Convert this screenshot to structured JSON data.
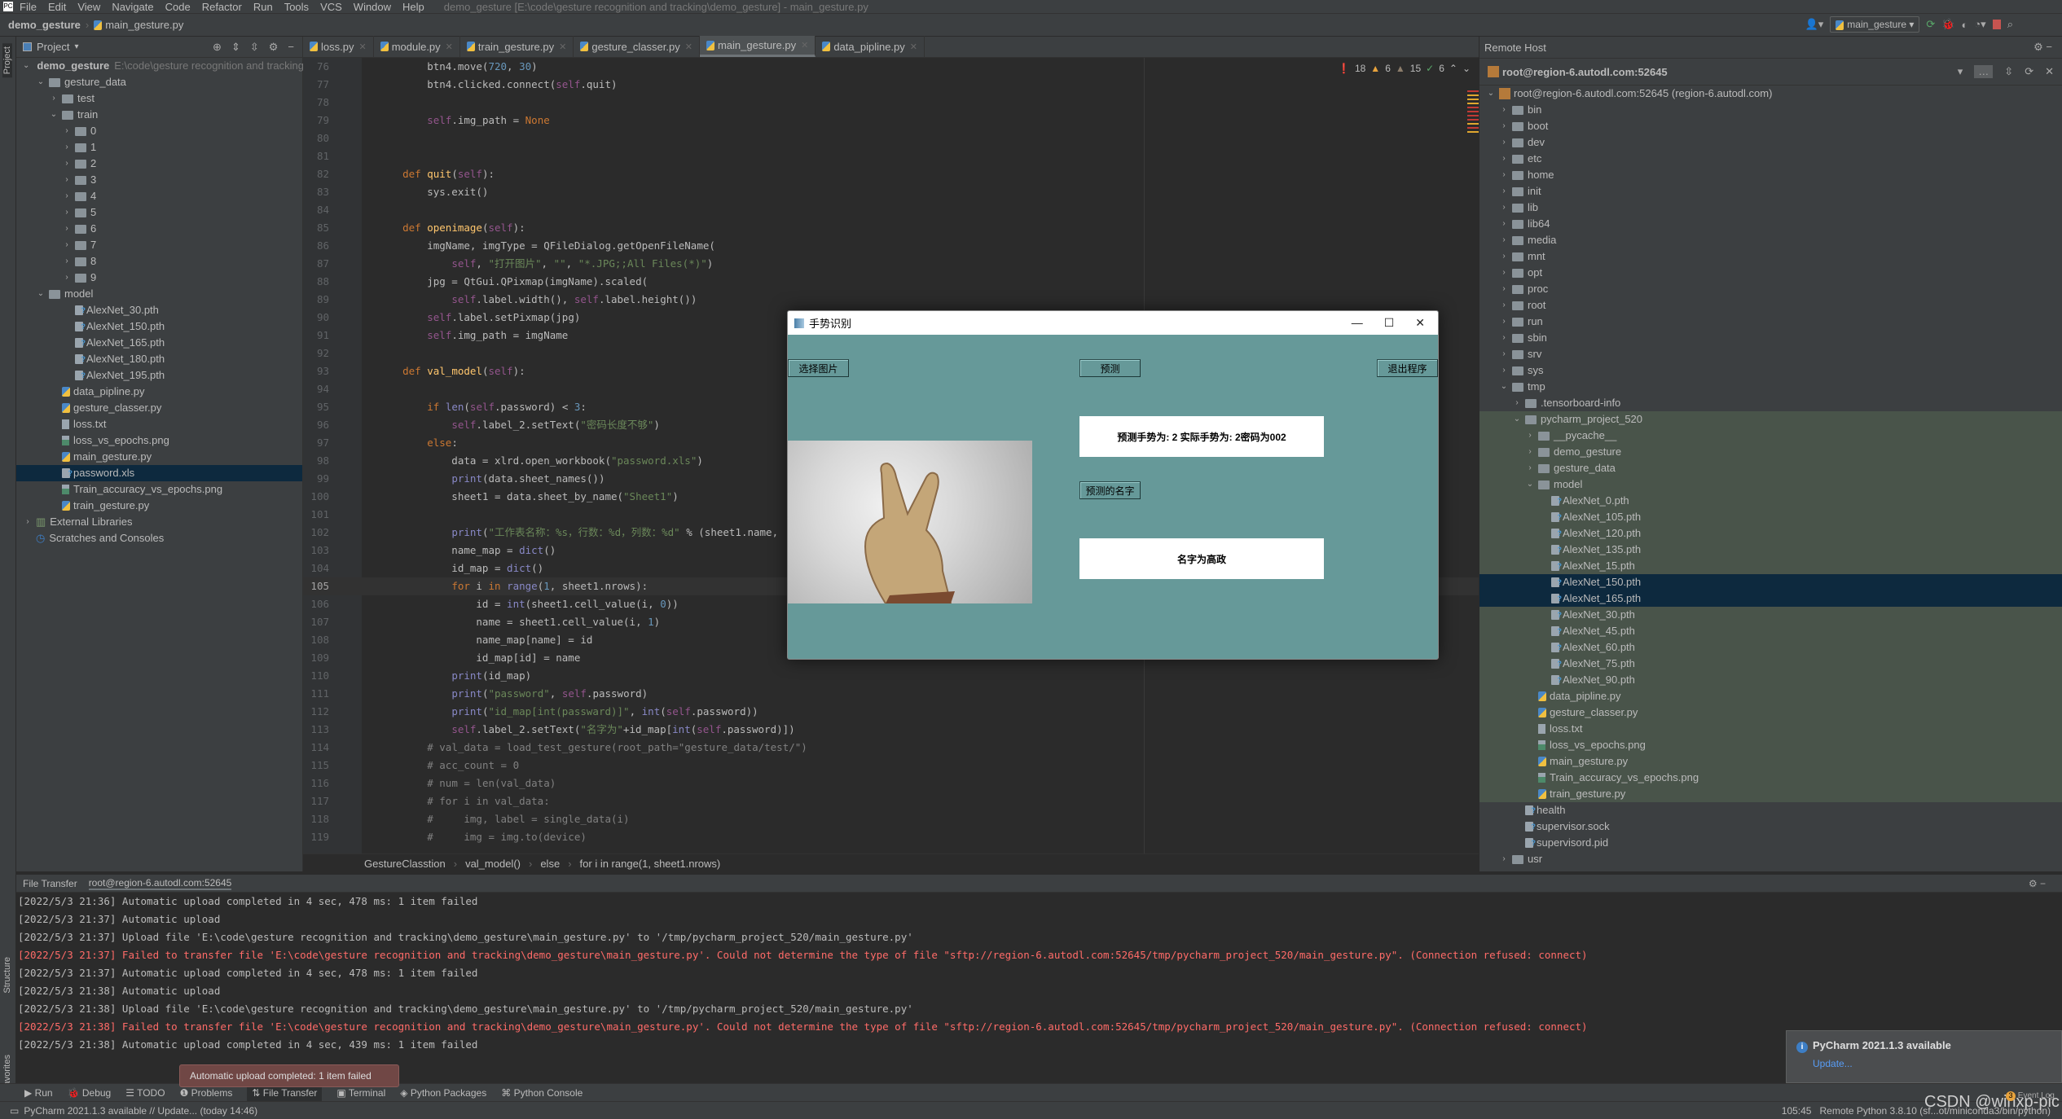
{
  "menubar": {
    "items": [
      "File",
      "Edit",
      "View",
      "Navigate",
      "Code",
      "Refactor",
      "Run",
      "Tools",
      "VCS",
      "Window",
      "Help"
    ],
    "window_title": "demo_gesture [E:\\code\\gesture recognition and tracking\\demo_gesture] - main_gesture.py"
  },
  "navbar": {
    "project": "demo_gesture",
    "file": "main_gesture.py",
    "run_config": "main_gesture"
  },
  "project_panel": {
    "title": "Project",
    "root": "demo_gesture",
    "root_path": "E:\\code\\gesture recognition and tracking",
    "items": [
      {
        "label": "gesture_data",
        "type": "folder",
        "depth": 1,
        "expanded": true
      },
      {
        "label": "test",
        "type": "folder",
        "depth": 2,
        "expanded": false
      },
      {
        "label": "train",
        "type": "folder",
        "depth": 2,
        "expanded": true
      },
      {
        "label": "0",
        "type": "folder",
        "depth": 3,
        "expanded": false
      },
      {
        "label": "1",
        "type": "folder",
        "depth": 3,
        "expanded": false
      },
      {
        "label": "2",
        "type": "folder",
        "depth": 3,
        "expanded": false
      },
      {
        "label": "3",
        "type": "folder",
        "depth": 3,
        "expanded": false
      },
      {
        "label": "4",
        "type": "folder",
        "depth": 3,
        "expanded": false
      },
      {
        "label": "5",
        "type": "folder",
        "depth": 3,
        "expanded": false
      },
      {
        "label": "6",
        "type": "folder",
        "depth": 3,
        "expanded": false
      },
      {
        "label": "7",
        "type": "folder",
        "depth": 3,
        "expanded": false
      },
      {
        "label": "8",
        "type": "folder",
        "depth": 3,
        "expanded": false
      },
      {
        "label": "9",
        "type": "folder",
        "depth": 3,
        "expanded": false
      },
      {
        "label": "model",
        "type": "folder",
        "depth": 1,
        "expanded": true
      },
      {
        "label": "AlexNet_30.pth",
        "type": "unknown",
        "depth": 3
      },
      {
        "label": "AlexNet_150.pth",
        "type": "unknown",
        "depth": 3
      },
      {
        "label": "AlexNet_165.pth",
        "type": "unknown",
        "depth": 3
      },
      {
        "label": "AlexNet_180.pth",
        "type": "unknown",
        "depth": 3
      },
      {
        "label": "AlexNet_195.pth",
        "type": "unknown",
        "depth": 3
      },
      {
        "label": "data_pipline.py",
        "type": "py",
        "depth": 2
      },
      {
        "label": "gesture_classer.py",
        "type": "py",
        "depth": 2
      },
      {
        "label": "loss.txt",
        "type": "txt",
        "depth": 2
      },
      {
        "label": "loss_vs_epochs.png",
        "type": "img",
        "depth": 2
      },
      {
        "label": "main_gesture.py",
        "type": "py",
        "depth": 2
      },
      {
        "label": "password.xls",
        "type": "unknown",
        "depth": 2,
        "selected": true
      },
      {
        "label": "Train_accuracy_vs_epochs.png",
        "type": "img",
        "depth": 2
      },
      {
        "label": "train_gesture.py",
        "type": "py",
        "depth": 2
      }
    ],
    "external_libraries": "External Libraries",
    "scratches": "Scratches and Consoles"
  },
  "tabs": [
    {
      "label": "loss.py",
      "active": false
    },
    {
      "label": "module.py",
      "active": false
    },
    {
      "label": "train_gesture.py",
      "active": false
    },
    {
      "label": "gesture_classer.py",
      "active": false
    },
    {
      "label": "main_gesture.py",
      "active": true
    },
    {
      "label": "data_pipline.py",
      "active": false
    }
  ],
  "inspections": {
    "errors": "18",
    "warnings": "6",
    "weak_warnings": "15",
    "typos": "6"
  },
  "code": [
    {
      "n": "76",
      "html": "        btn4.move(<span class=nm>720</span>, <span class=nm>30</span>)"
    },
    {
      "n": "77",
      "html": "        btn4.clicked.connect(<span class=sf>self</span>.quit)"
    },
    {
      "n": "78",
      "html": ""
    },
    {
      "n": "79",
      "html": "        <span class=sf>self</span>.img_path = <span class=kw>None</span>"
    },
    {
      "n": "80",
      "html": ""
    },
    {
      "n": "81",
      "html": ""
    },
    {
      "n": "82",
      "html": "    <span class=kw>def</span> <span class=fn>quit</span>(<span class=sf>self</span>):"
    },
    {
      "n": "83",
      "html": "        sys.exit()"
    },
    {
      "n": "84",
      "html": ""
    },
    {
      "n": "85",
      "html": "    <span class=kw>def</span> <span class=fn>openimage</span>(<span class=sf>self</span>):"
    },
    {
      "n": "86",
      "html": "        imgName, imgType = QFileDialog.getOpenFileName("
    },
    {
      "n": "87",
      "html": "            <span class=sf>self</span>, <span class=st>\"打开图片\"</span>, <span class=st>\"\"</span>, <span class=st>\"*.JPG;;All Files(*)\"</span>)"
    },
    {
      "n": "88",
      "html": "        jpg = QtGui.QPixmap(imgName).scaled("
    },
    {
      "n": "89",
      "html": "            <span class=sf>self</span>.label.width(), <span class=sf>self</span>.label.height())"
    },
    {
      "n": "90",
      "html": "        <span class=sf>self</span>.label.setPixmap(jpg)"
    },
    {
      "n": "91",
      "html": "        <span class=sf>self</span>.img_path = imgName"
    },
    {
      "n": "92",
      "html": ""
    },
    {
      "n": "93",
      "html": "    <span class=kw>def</span> <span class=fn>val_model</span>(<span class=sf>self</span>):"
    },
    {
      "n": "94",
      "html": ""
    },
    {
      "n": "95",
      "html": "        <span class=kw>if</span> <span class=bi>len</span>(<span class=sf>self</span>.password) &lt; <span class=nm>3</span>:"
    },
    {
      "n": "96",
      "html": "            <span class=sf>self</span>.label_2.setText(<span class=st>\"密码长度不够\"</span>)"
    },
    {
      "n": "97",
      "html": "        <span class=kw>else</span>:"
    },
    {
      "n": "98",
      "html": "            data = xlrd.open_workbook(<span class=st>\"password.xls\"</span>)"
    },
    {
      "n": "99",
      "html": "            <span class=bi>print</span>(data.sheet_names())"
    },
    {
      "n": "100",
      "html": "            sheet1 = data.sheet_by_name(<span class=st>\"Sheet1\"</span>)"
    },
    {
      "n": "101",
      "html": ""
    },
    {
      "n": "102",
      "html": "            <span class=bi>print</span>(<span class=st>\"工作表名称：%s，行数：%d，列数：%d\"</span> % (sheet1.name,"
    },
    {
      "n": "103",
      "html": "            name_map = <span class=bi>dict</span>()"
    },
    {
      "n": "104",
      "html": "            id_map = <span class=bi>dict</span>()"
    },
    {
      "n": "105",
      "html": "            <span class=kw>for</span> i <span class=kw>in</span> <span class=bi>range</span>(<span class=nm>1</span>, sheet1.nrows):",
      "cur": true
    },
    {
      "n": "106",
      "html": "                id = <span class=bi>int</span>(sheet1.cell_value(i, <span class=nm>0</span>))"
    },
    {
      "n": "107",
      "html": "                name = sheet1.cell_value(i, <span class=nm>1</span>)"
    },
    {
      "n": "108",
      "html": "                name_map[name] = id"
    },
    {
      "n": "109",
      "html": "                id_map[id] = name"
    },
    {
      "n": "110",
      "html": "            <span class=bi>print</span>(id_map)"
    },
    {
      "n": "111",
      "html": "            <span class=bi>print</span>(<span class=st>\"password\"</span>, <span class=sf>self</span>.password)"
    },
    {
      "n": "112",
      "html": "            <span class=bi>print</span>(<span class=st>\"id_map[int(passward)]\"</span>, <span class=bi>int</span>(<span class=sf>self</span>.password))"
    },
    {
      "n": "113",
      "html": "            <span class=sf>self</span>.label_2.setText(<span class=st>\"名字为\"</span>+id_map[<span class=bi>int</span>(<span class=sf>self</span>.password)])"
    },
    {
      "n": "114",
      "html": "        <span class=cm># val_data = load_test_gesture(root_path=\"gesture_data/test/\")</span>"
    },
    {
      "n": "115",
      "html": "        <span class=cm># acc_count = 0</span>"
    },
    {
      "n": "116",
      "html": "        <span class=cm># num = len(val_data)</span>"
    },
    {
      "n": "117",
      "html": "        <span class=cm># for i in val_data:</span>"
    },
    {
      "n": "118",
      "html": "        <span class=cm>#     img, label = single_data(i)</span>"
    },
    {
      "n": "119",
      "html": "        <span class=cm>#     img = img.to(device)</span>"
    }
  ],
  "breadcrumb": [
    "GestureClasstion",
    "val_model()",
    "else",
    "for i in range(1, sheet1.nrows)"
  ],
  "remote": {
    "title": "Remote Host",
    "host": "root@region-6.autodl.com:52645",
    "root_label": "root@region-6.autodl.com:52645 (region-6.autodl.com)",
    "items": [
      {
        "label": "bin",
        "type": "folder",
        "depth": 1
      },
      {
        "label": "boot",
        "type": "folder",
        "depth": 1
      },
      {
        "label": "dev",
        "type": "folder",
        "depth": 1
      },
      {
        "label": "etc",
        "type": "folder",
        "depth": 1
      },
      {
        "label": "home",
        "type": "folder",
        "depth": 1
      },
      {
        "label": "init",
        "type": "folder",
        "depth": 1
      },
      {
        "label": "lib",
        "type": "folder",
        "depth": 1
      },
      {
        "label": "lib64",
        "type": "folder",
        "depth": 1
      },
      {
        "label": "media",
        "type": "folder",
        "depth": 1
      },
      {
        "label": "mnt",
        "type": "folder",
        "depth": 1
      },
      {
        "label": "opt",
        "type": "folder",
        "depth": 1
      },
      {
        "label": "proc",
        "type": "folder",
        "depth": 1
      },
      {
        "label": "root",
        "type": "folder",
        "depth": 1
      },
      {
        "label": "run",
        "type": "folder",
        "depth": 1
      },
      {
        "label": "sbin",
        "type": "folder",
        "depth": 1
      },
      {
        "label": "srv",
        "type": "folder",
        "depth": 1
      },
      {
        "label": "sys",
        "type": "folder",
        "depth": 1
      },
      {
        "label": "tmp",
        "type": "folder",
        "depth": 1,
        "expanded": true
      },
      {
        "label": ".tensorboard-info",
        "type": "folder",
        "depth": 2
      },
      {
        "label": "pycharm_project_520",
        "type": "folder",
        "depth": 2,
        "expanded": true,
        "mapped": true
      },
      {
        "label": "__pycache__",
        "type": "folder",
        "depth": 3,
        "mapped": true
      },
      {
        "label": "demo_gesture",
        "type": "folder",
        "depth": 3,
        "mapped": true
      },
      {
        "label": "gesture_data",
        "type": "folder",
        "depth": 3,
        "mapped": true
      },
      {
        "label": "model",
        "type": "folder",
        "depth": 3,
        "expanded": true,
        "mapped": true
      },
      {
        "label": "AlexNet_0.pth",
        "type": "unknown",
        "depth": 4,
        "mapped": true
      },
      {
        "label": "AlexNet_105.pth",
        "type": "unknown",
        "depth": 4,
        "mapped": true
      },
      {
        "label": "AlexNet_120.pth",
        "type": "unknown",
        "depth": 4,
        "mapped": true
      },
      {
        "label": "AlexNet_135.pth",
        "type": "unknown",
        "depth": 4,
        "mapped": true
      },
      {
        "label": "AlexNet_15.pth",
        "type": "unknown",
        "depth": 4,
        "mapped": true
      },
      {
        "label": "AlexNet_150.pth",
        "type": "unknown",
        "depth": 4,
        "selected": true
      },
      {
        "label": "AlexNet_165.pth",
        "type": "unknown",
        "depth": 4,
        "selected": true
      },
      {
        "label": "AlexNet_30.pth",
        "type": "unknown",
        "depth": 4,
        "mapped": true
      },
      {
        "label": "AlexNet_45.pth",
        "type": "unknown",
        "depth": 4,
        "mapped": true
      },
      {
        "label": "AlexNet_60.pth",
        "type": "unknown",
        "depth": 4,
        "mapped": true
      },
      {
        "label": "AlexNet_75.pth",
        "type": "unknown",
        "depth": 4,
        "mapped": true
      },
      {
        "label": "AlexNet_90.pth",
        "type": "unknown",
        "depth": 4,
        "mapped": true
      },
      {
        "label": "data_pipline.py",
        "type": "py",
        "depth": 3,
        "mapped": true
      },
      {
        "label": "gesture_classer.py",
        "type": "py",
        "depth": 3,
        "mapped": true
      },
      {
        "label": "loss.txt",
        "type": "txt",
        "depth": 3,
        "mapped": true
      },
      {
        "label": "loss_vs_epochs.png",
        "type": "img",
        "depth": 3,
        "mapped": true
      },
      {
        "label": "main_gesture.py",
        "type": "py",
        "depth": 3,
        "mapped": true
      },
      {
        "label": "Train_accuracy_vs_epochs.png",
        "type": "img",
        "depth": 3,
        "mapped": true
      },
      {
        "label": "train_gesture.py",
        "type": "py",
        "depth": 3,
        "mapped": true
      },
      {
        "label": "health",
        "type": "unknown",
        "depth": 2
      },
      {
        "label": "supervisor.sock",
        "type": "unknown",
        "depth": 2
      },
      {
        "label": "supervisord.pid",
        "type": "unknown",
        "depth": 2
      },
      {
        "label": "usr",
        "type": "folder",
        "depth": 1
      }
    ]
  },
  "bottom_panel": {
    "tabs": [
      "File Transfer",
      "root@region-6.autodl.com:52645"
    ],
    "log": [
      {
        "text": "[2022/5/3 21:36] Automatic upload completed in 4 sec, 478 ms: 1 item failed",
        "err": false
      },
      {
        "text": "[2022/5/3 21:37] Automatic upload",
        "err": false
      },
      {
        "text": "[2022/5/3 21:37] Upload file 'E:\\code\\gesture recognition and tracking\\demo_gesture\\main_gesture.py' to '/tmp/pycharm_project_520/main_gesture.py'",
        "err": false
      },
      {
        "text": "[2022/5/3 21:37] Failed to transfer file 'E:\\code\\gesture recognition and tracking\\demo_gesture\\main_gesture.py'. Could not determine the type of file \"sftp://region-6.autodl.com:52645/tmp/pycharm_project_520/main_gesture.py\". (Connection refused: connect)",
        "err": true
      },
      {
        "text": "[2022/5/3 21:37] Automatic upload completed in 4 sec, 478 ms: 1 item failed",
        "err": false
      },
      {
        "text": "[2022/5/3 21:38] Automatic upload",
        "err": false
      },
      {
        "text": "[2022/5/3 21:38] Upload file 'E:\\code\\gesture recognition and tracking\\demo_gesture\\main_gesture.py' to '/tmp/pycharm_project_520/main_gesture.py'",
        "err": false
      },
      {
        "text": "[2022/5/3 21:38] Failed to transfer file 'E:\\code\\gesture recognition and tracking\\demo_gesture\\main_gesture.py'. Could not determine the type of file \"sftp://region-6.autodl.com:52645/tmp/pycharm_project_520/main_gesture.py\". (Connection refused: connect)",
        "err": true
      },
      {
        "text": "[2022/5/3 21:38] Automatic upload completed in 4 sec, 439 ms: 1 item failed",
        "err": false
      }
    ]
  },
  "left_strip": {
    "project": "Project",
    "structure": "Structure",
    "favorites": "Favorites"
  },
  "toolwindows": [
    "Run",
    "Debug",
    "TODO",
    "Problems",
    "File Transfer",
    "Terminal",
    "Python Packages",
    "Python Console"
  ],
  "toolwindow_active": "File Transfer",
  "balloon": "Automatic upload completed: 1 item failed",
  "notification": {
    "title": "PyCharm 2021.1.3 available",
    "link": "Update..."
  },
  "statusbar": {
    "left": "PyCharm 2021.1.3 available // Update... (today 14:46)",
    "position": "105:45",
    "interpreter": "Remote Python 3.8.10 (sf...ot/miniconda3/bin/python)",
    "event_log": "Event Log",
    "event_count": "3"
  },
  "watermark": "CSDN @winxp-pic",
  "dialog": {
    "title": "手势识别",
    "btn_select": "选择图片",
    "btn_predict": "预测",
    "btn_exit": "退出程序",
    "btn_name": "预测的名字",
    "result_label": "预测手势为: 2 实际手势为: 2密码为002",
    "name_label": "名字为高政",
    "bg_color": "#669999"
  }
}
